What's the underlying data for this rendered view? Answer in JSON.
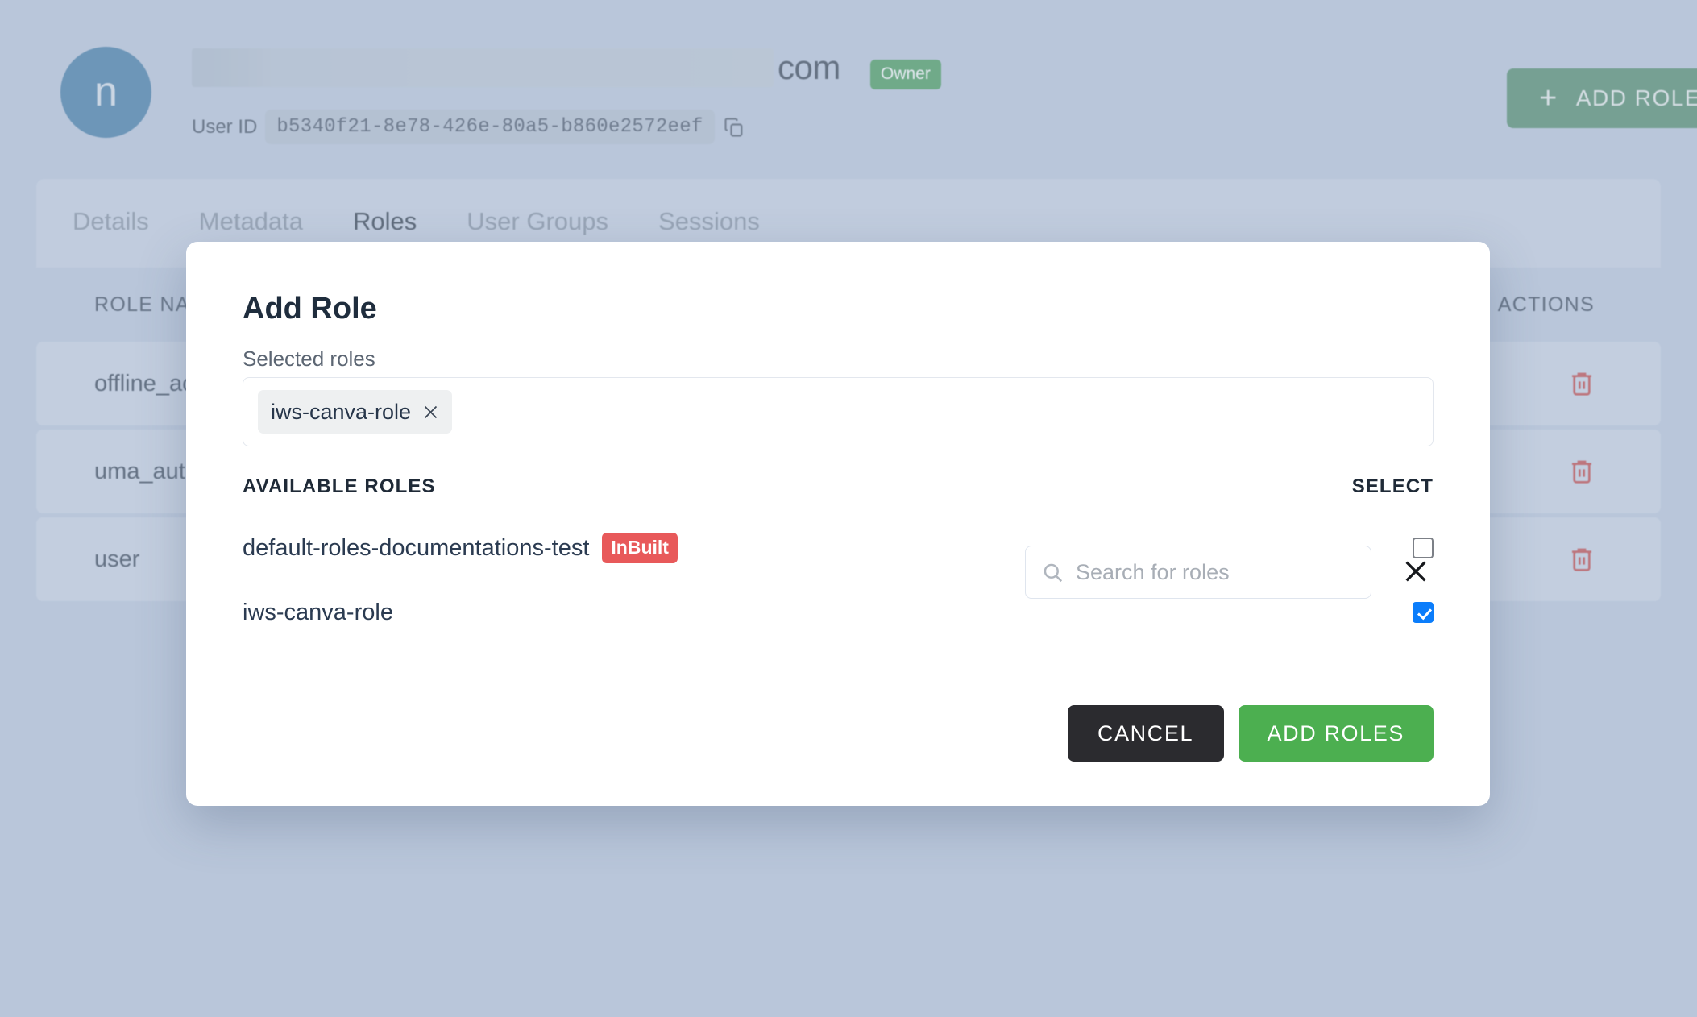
{
  "header": {
    "avatar_initial": "n",
    "name_tld": "com",
    "owner_badge": "Owner",
    "user_id_label": "User ID",
    "user_id_value": "b5340f21-8e78-426e-80a5-b860e2572eef",
    "copy_icon": "copy-icon",
    "add_role_button": "ADD ROLE",
    "add_role_plus": "+"
  },
  "tabs": [
    {
      "label": "Details",
      "active": false
    },
    {
      "label": "Metadata",
      "active": false
    },
    {
      "label": "Roles",
      "active": true
    },
    {
      "label": "User Groups",
      "active": false
    },
    {
      "label": "Sessions",
      "active": false
    }
  ],
  "table": {
    "columns": {
      "name": "ROLE NAME",
      "actions": "ACTIONS"
    },
    "rows": [
      {
        "name": "offline_access",
        "action_icon": "trash-icon"
      },
      {
        "name": "uma_authorization",
        "action_icon": "trash-icon"
      },
      {
        "name": "user",
        "action_icon": "trash-icon"
      }
    ]
  },
  "modal": {
    "title": "Add Role",
    "search": {
      "placeholder": "Search for roles",
      "value": "",
      "icon": "search-icon"
    },
    "close_icon": "close-icon",
    "selected_roles_label": "Selected roles",
    "selected_chips": [
      {
        "label": "iws-canva-role",
        "remove_icon": "close-icon"
      }
    ],
    "available_header": "AVAILABLE ROLES",
    "select_header": "SELECT",
    "available_roles": [
      {
        "name": "default-roles-documentations-test",
        "badge": "InBuilt",
        "checked": false
      },
      {
        "name": "iws-canva-role",
        "badge": "",
        "checked": true
      }
    ],
    "cancel_label": "CANCEL",
    "add_label": "ADD ROLES"
  },
  "colors": {
    "page_bg": "#b9c6da",
    "avatar": "#2f7cb5",
    "owner_green": "#2fa24a",
    "add_role_green": "#4caf50",
    "inbuilt_red": "#e8595a",
    "trash_red": "#e03b3b",
    "checkbox_blue": "#0b7dfb",
    "cancel_dark": "#2b2b2f"
  }
}
